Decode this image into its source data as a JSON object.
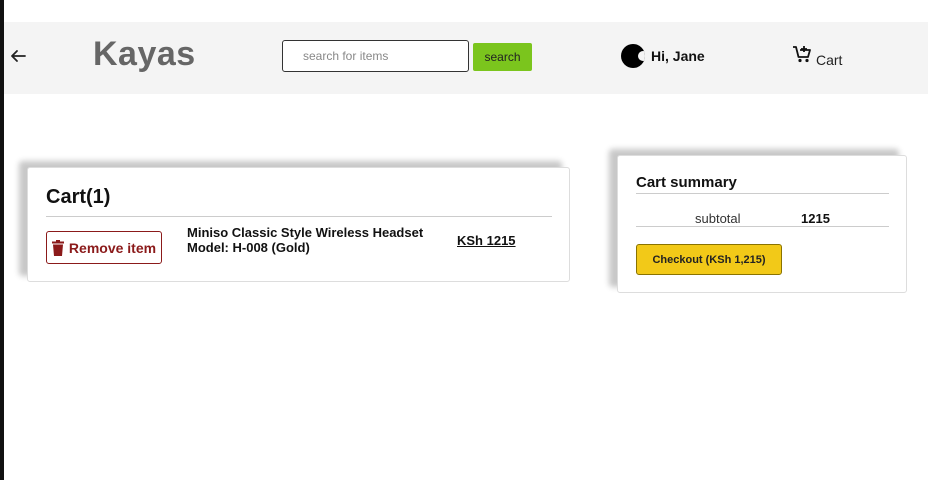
{
  "header": {
    "brand": "Kayas",
    "search": {
      "placeholder": "search for items",
      "button_label": "search"
    },
    "user_greeting": "Hi, Jane",
    "cart_label": "Cart",
    "icons": {
      "back": "arrow-left-icon",
      "avatar": "user-avatar-icon",
      "cart": "cart-add-icon"
    }
  },
  "cart": {
    "title": "Cart(1)",
    "items": [
      {
        "remove_label": "Remove item",
        "name_line1": "Miniso Classic Style Wireless Headset",
        "name_line2": "Model: H-008 (Gold)",
        "price": "KSh 1215"
      }
    ]
  },
  "summary": {
    "title": "Cart summary",
    "subtotal_label": "subtotal",
    "subtotal_value": "1215",
    "checkout_label": "Checkout (KSh 1,215)"
  },
  "colors": {
    "search_button": "#7bc51d",
    "checkout_button": "#f2c918",
    "remove_accent": "#8b1a1a",
    "header_bg": "#f4f4f4"
  }
}
